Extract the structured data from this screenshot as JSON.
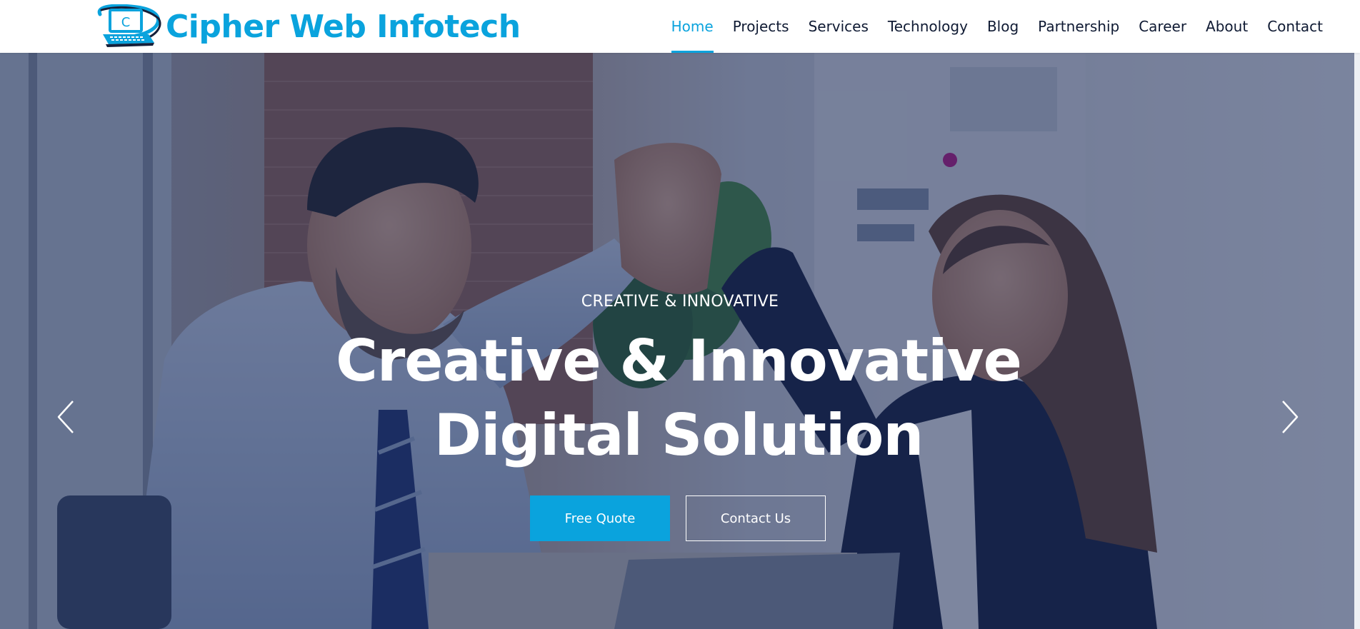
{
  "brand": {
    "name": "Cipher Web Infotech",
    "logo_letter": "C",
    "color": "#0aa3dd"
  },
  "nav": {
    "items": [
      {
        "label": "Home",
        "active": true
      },
      {
        "label": "Projects",
        "active": false
      },
      {
        "label": "Services",
        "active": false
      },
      {
        "label": "Technology",
        "active": false
      },
      {
        "label": "Blog",
        "active": false
      },
      {
        "label": "Partnership",
        "active": false
      },
      {
        "label": "Career",
        "active": false
      },
      {
        "label": "About",
        "active": false
      },
      {
        "label": "Contact",
        "active": false
      }
    ],
    "active_color": "#0aa3dd",
    "text_color": "#0f1a33"
  },
  "hero": {
    "eyebrow": "CREATIVE & INNOVATIVE",
    "title_line1": "Creative & Innovative",
    "title_line2": "Digital Solution",
    "primary_button": "Free Quote",
    "secondary_button": "Contact Us",
    "overlay_color": "#11214e",
    "prev_icon": "chevron-left-icon",
    "next_icon": "chevron-right-icon"
  }
}
